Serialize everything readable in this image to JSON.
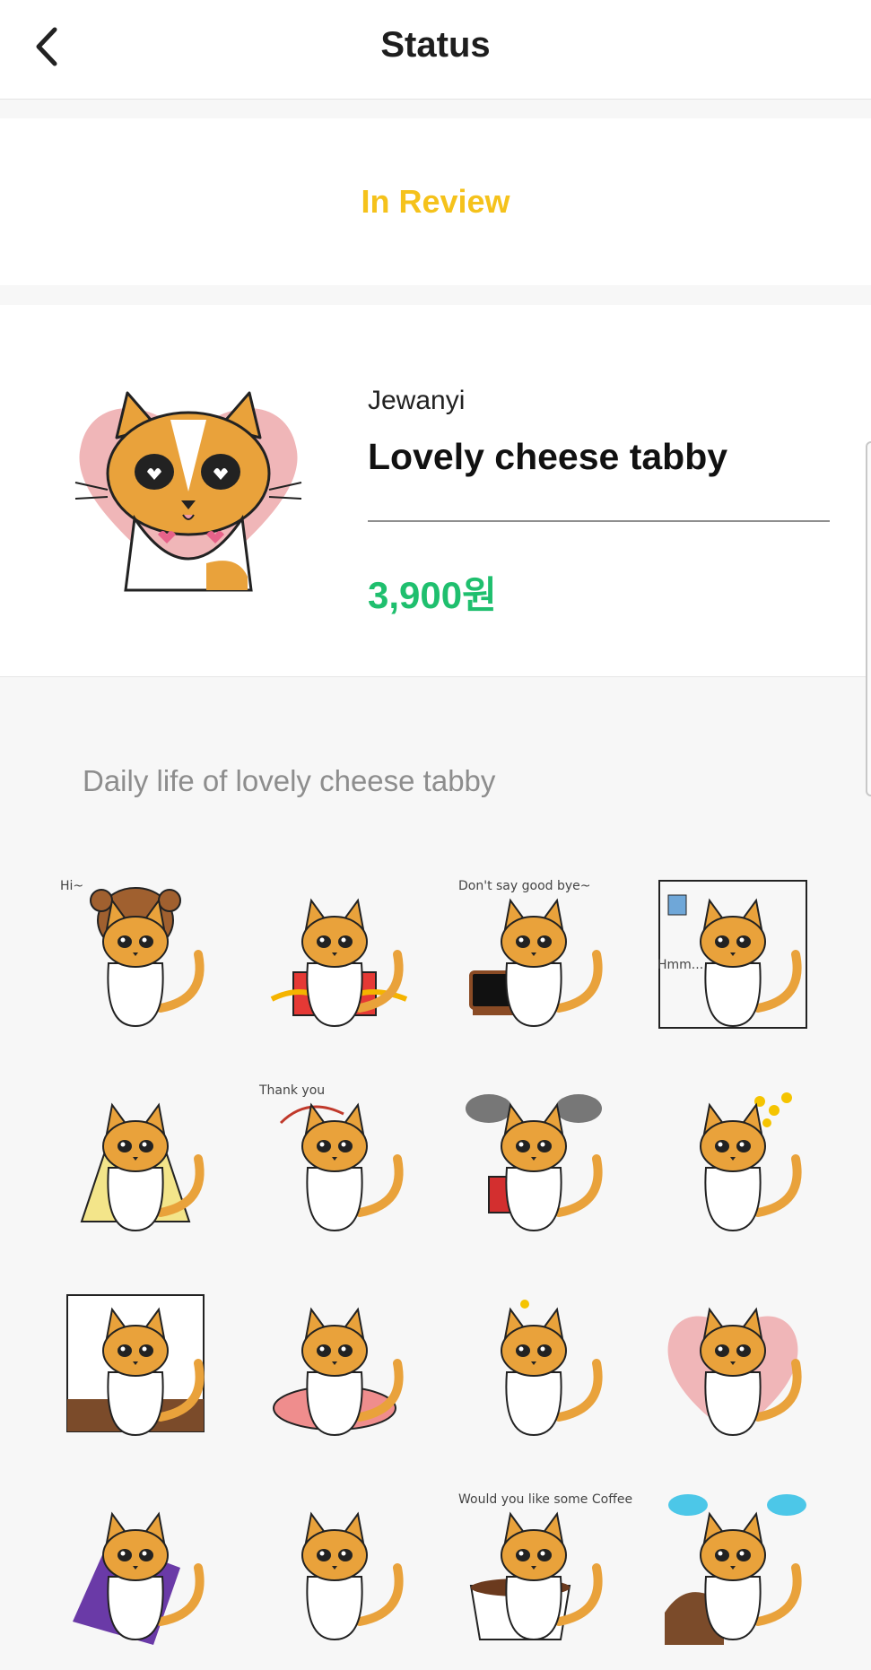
{
  "header": {
    "title": "Status",
    "back_icon": "chevron-left-icon"
  },
  "status": {
    "text": "In Review",
    "color": "#f5c21b"
  },
  "pack": {
    "author": "Jewanyi",
    "title": "Lovely cheese tabby",
    "price": "3,900원",
    "price_color": "#1fbf6e",
    "main_sticker": "cat-heart-thumbs-sticker"
  },
  "description": "Daily life of lovely cheese tabby",
  "stickers": [
    {
      "name": "cat-hi-bear-hat",
      "caption": "Hi~"
    },
    {
      "name": "cat-gift-box",
      "caption": ""
    },
    {
      "name": "cat-tv-goodbye",
      "caption": "Don't say good bye~"
    },
    {
      "name": "cat-hmm-door",
      "caption": "Hmm..."
    },
    {
      "name": "cat-blanket",
      "caption": ""
    },
    {
      "name": "cat-thank-you",
      "caption": "Thank you"
    },
    {
      "name": "cat-storm-cloud",
      "caption": ""
    },
    {
      "name": "cat-flowers",
      "caption": ""
    },
    {
      "name": "cat-window",
      "caption": ""
    },
    {
      "name": "cat-table-meal",
      "caption": ""
    },
    {
      "name": "cat-jumping",
      "caption": ""
    },
    {
      "name": "cat-heart-thumbs",
      "caption": ""
    },
    {
      "name": "cat-yoga-mat",
      "caption": ""
    },
    {
      "name": "cat-necktie",
      "caption": ""
    },
    {
      "name": "cat-coffee-cup",
      "caption": "Would you like some Coffee"
    },
    {
      "name": "cat-blue-clouds",
      "caption": ""
    }
  ]
}
